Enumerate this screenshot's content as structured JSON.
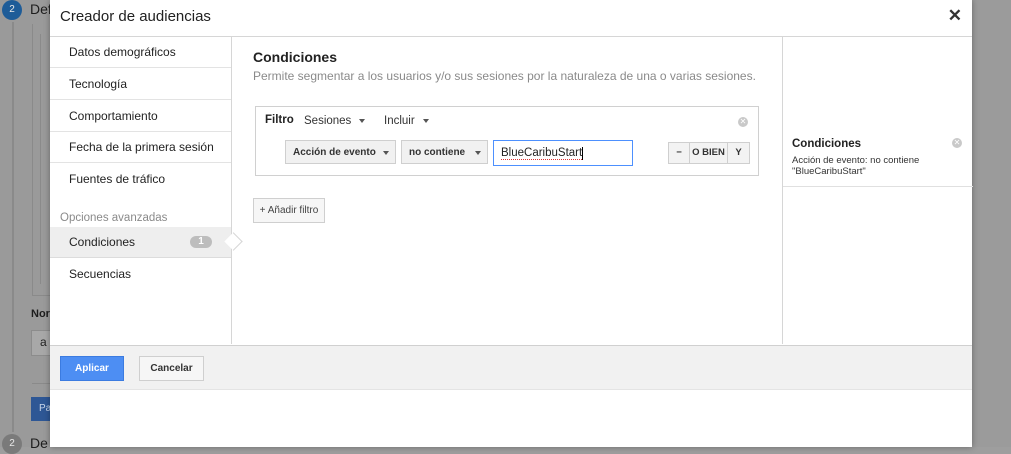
{
  "background": {
    "step1_number": "2",
    "step1_label": "Def",
    "name_label": "Nor",
    "name_input_value": "a",
    "button_label": "Pa",
    "step2_number": "2",
    "step2_label": "De"
  },
  "modal": {
    "title": "Creador de audiencias",
    "close_glyph": "✕"
  },
  "sidebar": {
    "items": [
      {
        "label": "Datos demográficos"
      },
      {
        "label": "Tecnología"
      },
      {
        "label": "Comportamiento"
      },
      {
        "label": "Fecha de la primera sesión"
      },
      {
        "label": "Fuentes de tráfico"
      }
    ],
    "advanced_section": "Opciones avanzadas",
    "advanced_items": [
      {
        "label": "Condiciones",
        "badge": "1",
        "active": true
      },
      {
        "label": "Secuencias"
      }
    ]
  },
  "main": {
    "title": "Condiciones",
    "description": "Permite segmentar a los usuarios y/o sus sesiones por la naturaleza de una o varias sesiones.",
    "filter": {
      "label": "Filtro",
      "scope_dropdown": "Sesiones",
      "include_dropdown": "Incluir",
      "dimension_select": "Acción de evento",
      "operator_select": "no contiene",
      "value_input": "BlueCaribuStart",
      "minus_label": "−",
      "or_label": "O BIEN",
      "and_label": "Y"
    },
    "add_filter_label": "+ Añadir filtro"
  },
  "summary": {
    "title": "Condiciones",
    "description": "Acción de evento: no contiene \"BlueCaribuStart\""
  },
  "footer": {
    "apply_label": "Aplicar",
    "cancel_label": "Cancelar"
  },
  "colors": {
    "primary_button": "#4d8ef3",
    "input_focus": "#4d90fe",
    "badge": "#bdbdbd",
    "step_indicator": "#1e5c98"
  }
}
